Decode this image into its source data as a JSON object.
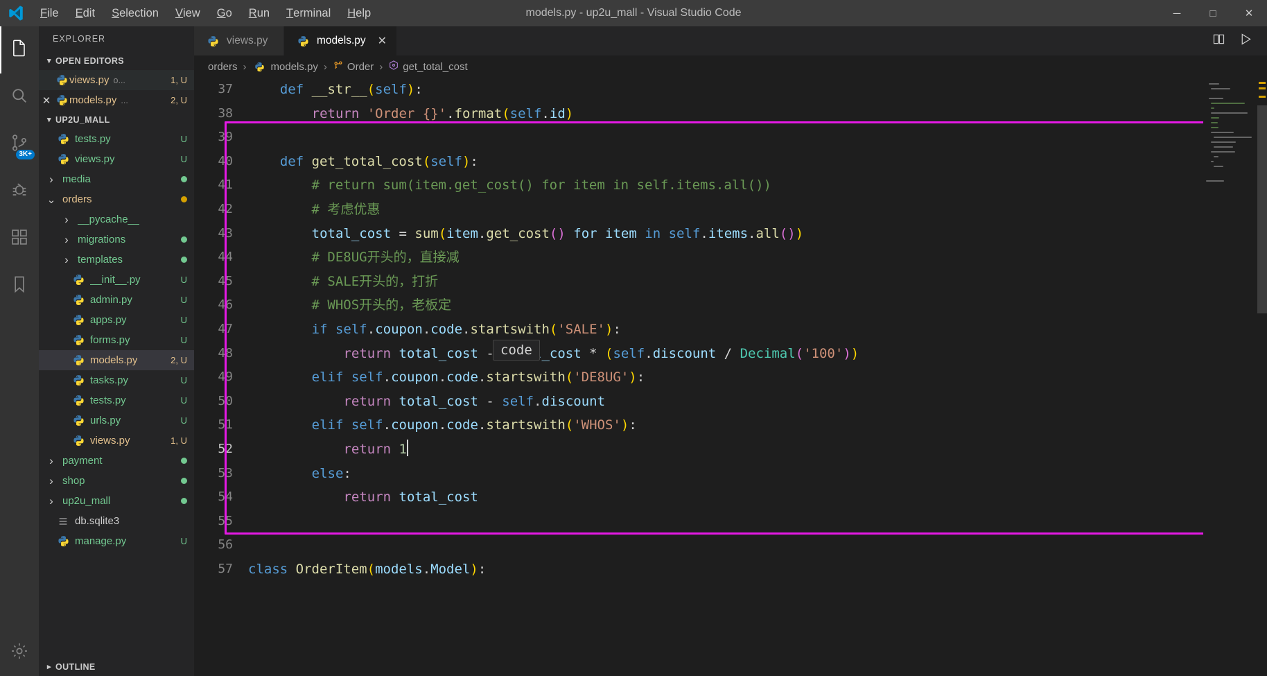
{
  "window": {
    "title": "models.py - up2u_mall - Visual Studio Code",
    "logo_name": "vscode-logo",
    "controls": {
      "minimize": "─",
      "maximize": "□",
      "close": "✕"
    }
  },
  "menubar": [
    {
      "label": "File",
      "mnemonic": "F"
    },
    {
      "label": "Edit",
      "mnemonic": "E"
    },
    {
      "label": "Selection",
      "mnemonic": "S"
    },
    {
      "label": "View",
      "mnemonic": "V"
    },
    {
      "label": "Go",
      "mnemonic": "G"
    },
    {
      "label": "Run",
      "mnemonic": "R"
    },
    {
      "label": "Terminal",
      "mnemonic": "T"
    },
    {
      "label": "Help",
      "mnemonic": "H"
    }
  ],
  "activitybar": {
    "items": [
      {
        "name": "explorer",
        "icon": "files-icon",
        "active": true
      },
      {
        "name": "search",
        "icon": "search-icon",
        "active": false
      },
      {
        "name": "source-control",
        "icon": "source-control-icon",
        "active": false,
        "badge": "3K+"
      },
      {
        "name": "run-and-debug",
        "icon": "debug-icon",
        "active": false
      },
      {
        "name": "extensions",
        "icon": "extensions-icon",
        "active": false
      },
      {
        "name": "bookmarks",
        "icon": "bookmark-icon",
        "active": false
      }
    ],
    "bottom": [
      {
        "name": "manage",
        "icon": "gear-icon"
      }
    ]
  },
  "sidebar": {
    "title": "EXPLORER",
    "open_editors": {
      "label": "OPEN EDITORS",
      "expanded": true,
      "items": [
        {
          "name": "views.py",
          "sub": "o...",
          "deco": "1, U",
          "icon": "python-icon",
          "dirty": false,
          "active": true
        },
        {
          "name": "models.py",
          "sub": "...",
          "deco": "2, U",
          "icon": "python-icon",
          "close": "✕",
          "active": false
        }
      ]
    },
    "workspace": {
      "label": "UP2U_MALL",
      "expanded": true,
      "items": [
        {
          "name": "tests.py",
          "type": "file",
          "indent": 1,
          "color": "green",
          "deco": "U",
          "icon": "python-icon"
        },
        {
          "name": "views.py",
          "type": "file",
          "indent": 1,
          "color": "green",
          "deco": "U",
          "icon": "python-icon"
        },
        {
          "name": "media",
          "type": "folder",
          "indent": 1,
          "color": "green",
          "dot": true,
          "expanded": false
        },
        {
          "name": "orders",
          "type": "folder",
          "indent": 1,
          "color": "yellow",
          "dot_y": true,
          "expanded": true
        },
        {
          "name": "__pycache__",
          "type": "folder",
          "indent": 2,
          "color": "green",
          "expanded": false
        },
        {
          "name": "migrations",
          "type": "folder",
          "indent": 2,
          "color": "green",
          "dot": true,
          "expanded": false
        },
        {
          "name": "templates",
          "type": "folder",
          "indent": 2,
          "color": "green",
          "dot": true,
          "expanded": false
        },
        {
          "name": "__init__.py",
          "type": "file",
          "indent": 2,
          "color": "green",
          "deco": "U",
          "icon": "python-icon"
        },
        {
          "name": "admin.py",
          "type": "file",
          "indent": 2,
          "color": "green",
          "deco": "U",
          "icon": "python-icon"
        },
        {
          "name": "apps.py",
          "type": "file",
          "indent": 2,
          "color": "green",
          "deco": "U",
          "icon": "python-icon"
        },
        {
          "name": "forms.py",
          "type": "file",
          "indent": 2,
          "color": "green",
          "deco": "U",
          "icon": "python-icon"
        },
        {
          "name": "models.py",
          "type": "file",
          "indent": 2,
          "color": "yellow",
          "deco": "2, U",
          "icon": "python-icon",
          "selected": true
        },
        {
          "name": "tasks.py",
          "type": "file",
          "indent": 2,
          "color": "green",
          "deco": "U",
          "icon": "python-icon"
        },
        {
          "name": "tests.py",
          "type": "file",
          "indent": 2,
          "color": "green",
          "deco": "U",
          "icon": "python-icon"
        },
        {
          "name": "urls.py",
          "type": "file",
          "indent": 2,
          "color": "green",
          "deco": "U",
          "icon": "python-icon"
        },
        {
          "name": "views.py",
          "type": "file",
          "indent": 2,
          "color": "yellow",
          "deco": "1, U",
          "icon": "python-icon"
        },
        {
          "name": "payment",
          "type": "folder",
          "indent": 1,
          "color": "green",
          "dot": true,
          "expanded": false
        },
        {
          "name": "shop",
          "type": "folder",
          "indent": 1,
          "color": "green",
          "dot": true,
          "expanded": false
        },
        {
          "name": "up2u_mall",
          "type": "folder",
          "indent": 1,
          "color": "green",
          "dot": true,
          "expanded": false
        },
        {
          "name": "db.sqlite3",
          "type": "file",
          "indent": 1,
          "color": "grey",
          "icon": "database-icon"
        },
        {
          "name": "manage.py",
          "type": "file",
          "indent": 1,
          "color": "green",
          "deco": "U",
          "icon": "python-icon"
        }
      ]
    },
    "outline": {
      "label": "OUTLINE",
      "expanded": false
    }
  },
  "editor": {
    "tabs": [
      {
        "label": "views.py",
        "icon": "python-icon",
        "active": false
      },
      {
        "label": "models.py",
        "icon": "python-icon",
        "active": true,
        "close": "✕"
      }
    ],
    "tab_actions": [
      {
        "name": "split-editor-icon",
        "glyph": "⬚"
      },
      {
        "name": "run-python-file-icon",
        "glyph": "▷"
      }
    ],
    "breadcrumbs": [
      {
        "label": "orders",
        "icon": "folder-breadcrumb"
      },
      {
        "label": "models.py",
        "icon": "python-icon"
      },
      {
        "label": "Order",
        "icon": "class-icon"
      },
      {
        "label": "get_total_cost",
        "icon": "method-icon"
      }
    ],
    "first_line_number": 37,
    "cursor_line": 52,
    "hover_tooltip": "code",
    "highlight_color": "#e519e5",
    "lines": [
      {
        "n": 37,
        "text": "    def __str__(self):"
      },
      {
        "n": 38,
        "text": "        return 'Order {}'.format(self.id)"
      },
      {
        "n": 39,
        "text": ""
      },
      {
        "n": 40,
        "text": "    def get_total_cost(self):"
      },
      {
        "n": 41,
        "text": "        # return sum(item.get_cost() for item in self.items.all())"
      },
      {
        "n": 42,
        "text": "        # 考虑优惠"
      },
      {
        "n": 43,
        "text": "        total_cost = sum(item.get_cost() for item in self.items.all())"
      },
      {
        "n": 44,
        "text": "        # DE8UG开头的，直接减"
      },
      {
        "n": 45,
        "text": "        # SALE开头的，打折"
      },
      {
        "n": 46,
        "text": "        # WHOS开头的，老板定"
      },
      {
        "n": 47,
        "text": "        if self.coupon.code.startswith('SALE'):"
      },
      {
        "n": 48,
        "text": "            return total_cost - total_cost * (self.discount / Decimal('100'))"
      },
      {
        "n": 49,
        "text": "        elif self.coupon.code.startswith('DE8UG'):"
      },
      {
        "n": 50,
        "text": "            return total_cost - self.discount"
      },
      {
        "n": 51,
        "text": "        elif self.coupon.code.startswith('WHOS'):"
      },
      {
        "n": 52,
        "text": "            return 1"
      },
      {
        "n": 53,
        "text": "        else:"
      },
      {
        "n": 54,
        "text": "            return total_cost"
      },
      {
        "n": 55,
        "text": ""
      },
      {
        "n": 56,
        "text": ""
      },
      {
        "n": 57,
        "text": "class OrderItem(models.Model):"
      }
    ]
  },
  "colors": {
    "titlebar_bg": "#3c3c3c",
    "activitybar_bg": "#333333",
    "sidebar_bg": "#252526",
    "editor_bg": "#1e1e1e",
    "tab_active_bg": "#1e1e1e",
    "accent": "#007acc",
    "selection_bg": "#37373d",
    "git_untracked": "#73c991",
    "git_modified": "#e2c08d",
    "highlight_rect": "#e519e5"
  }
}
